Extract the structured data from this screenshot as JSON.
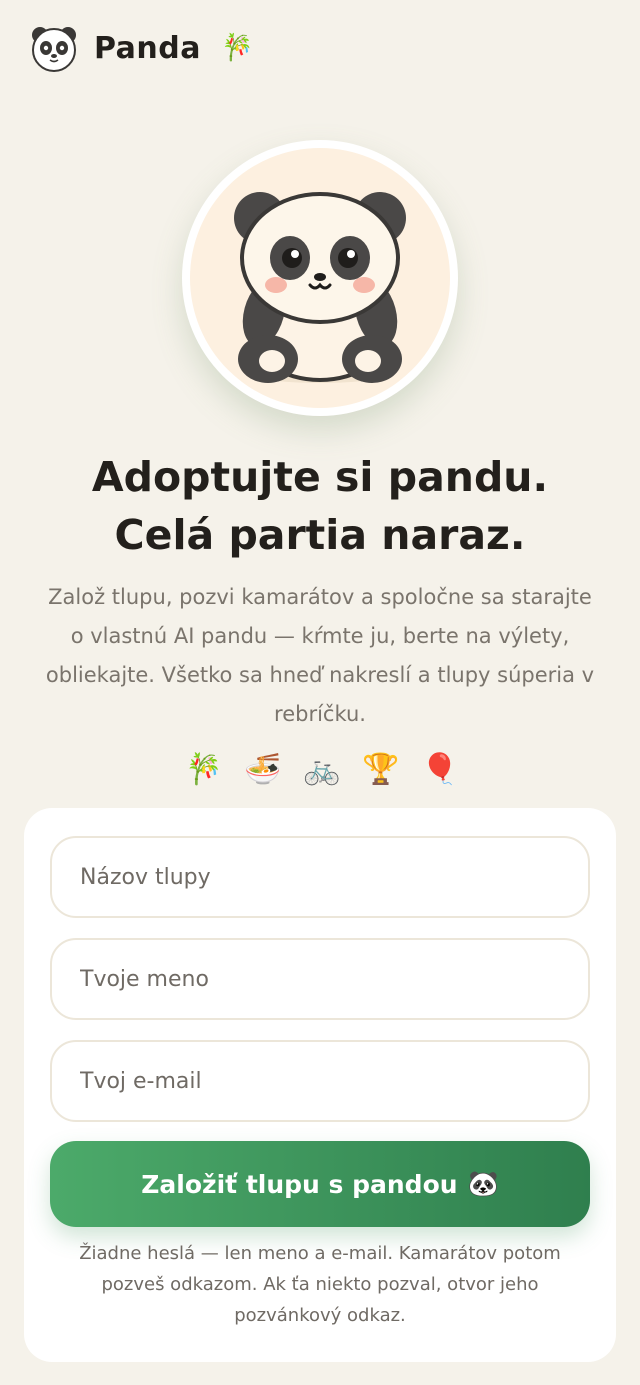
{
  "header": {
    "brand": "Panda",
    "brand_emoji": "🎋",
    "logo_icon": "panda-face-icon"
  },
  "hero": {
    "illustration": "panda-illustration",
    "title_line1": "Adoptujte si pandu.",
    "title_line2": "Celá partia naraz.",
    "description": "Založ tlupu, pozvi kamarátov a spoločne sa starajte o vlastnú AI pandu — kŕmte ju, berte na výlety, obliekajte. Všetko sa hneď nakreslí a tlupy súperia v rebríčku."
  },
  "features": [
    {
      "emoji": "🎋",
      "icon": "bamboo-icon"
    },
    {
      "emoji": "🍜",
      "icon": "noodles-icon"
    },
    {
      "emoji": "🚲",
      "icon": "bicycle-icon"
    },
    {
      "emoji": "🏆",
      "icon": "trophy-icon"
    },
    {
      "emoji": "🎈",
      "icon": "balloon-icon"
    }
  ],
  "form": {
    "group_placeholder": "Názov tlupy",
    "name_placeholder": "Tvoje meno",
    "email_placeholder": "Tvoj e-mail",
    "submit_label": "Založiť tlupu s pandou",
    "submit_emoji": "🐼",
    "note": "Žiadne heslá — len meno a e-mail. Kamarátov potom pozveš odkazom. Ak ťa niekto pozval, otvor jeho pozvánkový odkaz."
  },
  "colors": {
    "background": "#f5f2ea",
    "accent_start": "#4caa6a",
    "accent_end": "#2f7f4e",
    "text_dark": "#23201c",
    "text_muted": "#7a746c"
  }
}
